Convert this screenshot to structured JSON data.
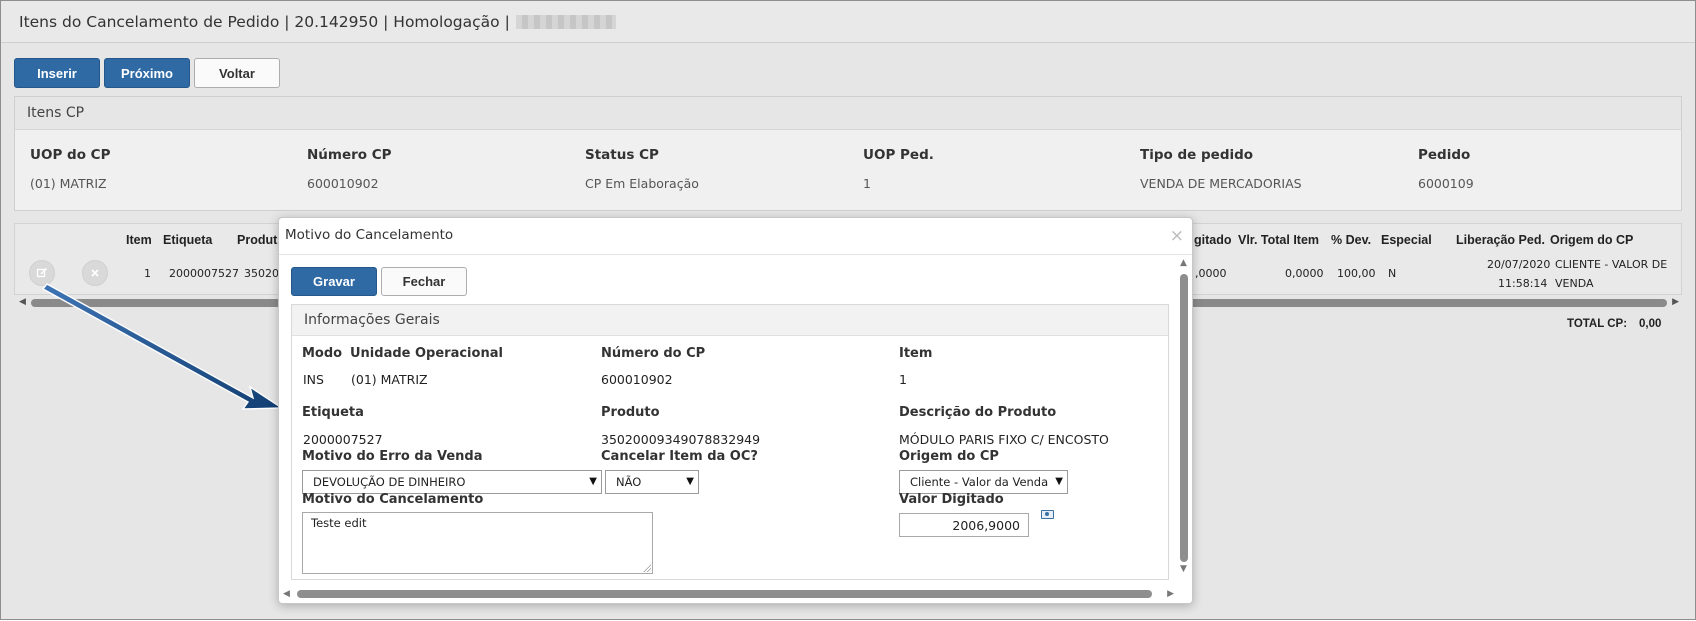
{
  "window": {
    "title": "Itens do Cancelamento de Pedido | 20.142950 | Homologação |"
  },
  "toolbar": {
    "insert_label": "Inserir",
    "next_label": "Próximo",
    "back_label": "Voltar"
  },
  "panel": {
    "title": "Itens CP",
    "fields": [
      {
        "label": "UOP do CP",
        "value": "(01) MATRIZ"
      },
      {
        "label": "Número CP",
        "value": "600010902"
      },
      {
        "label": "Status CP",
        "value": "CP Em Elaboração"
      },
      {
        "label": "UOP Ped.",
        "value": "1"
      },
      {
        "label": "Tipo de pedido",
        "value": "VENDA DE MERCADORIAS"
      },
      {
        "label": "Pedido",
        "value": "6000109"
      }
    ]
  },
  "grid": {
    "headers_left": [
      "Item",
      "Etiqueta",
      "Produt"
    ],
    "headers_right": [
      "gitado",
      "Vlr. Total Item",
      "% Dev.",
      "Especial",
      "Liberação Ped.",
      "Origem do CP"
    ],
    "row": {
      "item": "1",
      "etiqueta": "2000007527",
      "produto": "35020",
      "valor_digitado": ",0000",
      "vlr_total_item": "0,0000",
      "dev": "100,00",
      "especial": "N",
      "liberacao_date": "20/07/2020",
      "liberacao_time": "11:58:14",
      "origem_line1": "CLIENTE - VALOR DE",
      "origem_line2": "VENDA"
    },
    "total_label": "TOTAL CP:",
    "total_value": "0,00"
  },
  "modal": {
    "title": "Motivo do Cancelamento",
    "close_glyph": "×",
    "save_label": "Gravar",
    "close_label": "Fechar",
    "section_title": "Informações Gerais",
    "modo_label": "Modo",
    "modo_value": "INS",
    "uop_label": "Unidade Operacional",
    "uop_value": "(01) MATRIZ",
    "numero_label": "Número do CP",
    "numero_value": "600010902",
    "item_label": "Item",
    "item_value": "1",
    "etiqueta_label": "Etiqueta",
    "etiqueta_value": "2000007527",
    "produto_label": "Produto",
    "produto_value": "35020009349078832949",
    "descricao_label": "Descrição do Produto",
    "descricao_value": "MÓDULO PARIS FIXO C/ ENCOSTO",
    "motivo_erro_label": "Motivo do Erro da Venda",
    "motivo_erro_value": "DEVOLUÇÃO DE DINHEIRO",
    "cancelar_oc_label": "Cancelar Item da OC?",
    "cancelar_oc_value": "NÃO",
    "origem_label": "Origem do CP",
    "origem_value": "Cliente - Valor da Venda",
    "motivo_cancel_label": "Motivo do Cancelamento",
    "motivo_cancel_value": "Teste edit",
    "valor_label": "Valor Digitado",
    "valor_value": "2006,9000"
  },
  "colors": {
    "primary": "#2f6aa5",
    "annotation_arrow": "#1d4e86"
  }
}
